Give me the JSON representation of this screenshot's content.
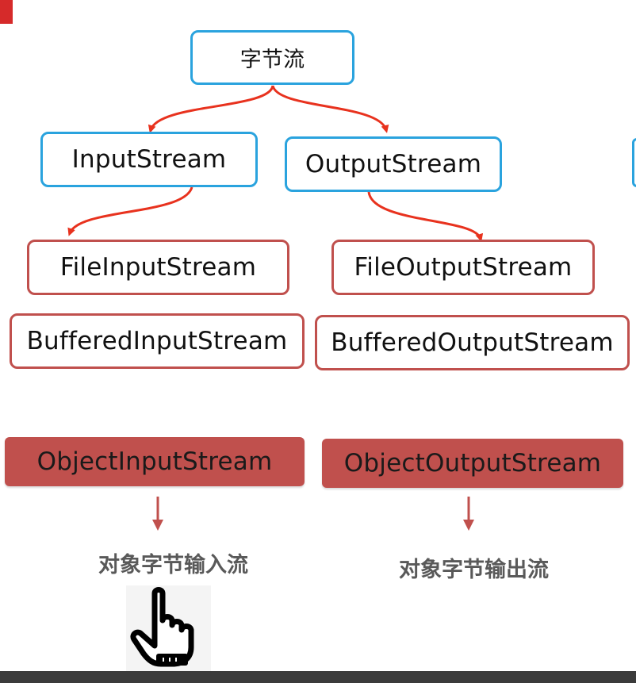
{
  "nodes": {
    "root": "字节流",
    "input_stream": "InputStream",
    "output_stream": "OutputStream",
    "file_input_stream": "FileInputStream",
    "file_output_stream": "FileOutputStream",
    "buffered_input_stream": "BufferedInputStream",
    "buffered_output_stream": "BufferedOutputStream",
    "object_input_stream": "ObjectInputStream",
    "object_output_stream": "ObjectOutputStream"
  },
  "labels": {
    "object_input_caption": "对象字节输入流",
    "object_output_caption": "对象字节输出流"
  },
  "colors": {
    "blue_border": "#2aa3de",
    "red_border": "#c0504d",
    "arrow_red": "#e8321e",
    "caption_gray": "#595959"
  },
  "icons": {
    "pointer": "pointing-hand-icon"
  }
}
